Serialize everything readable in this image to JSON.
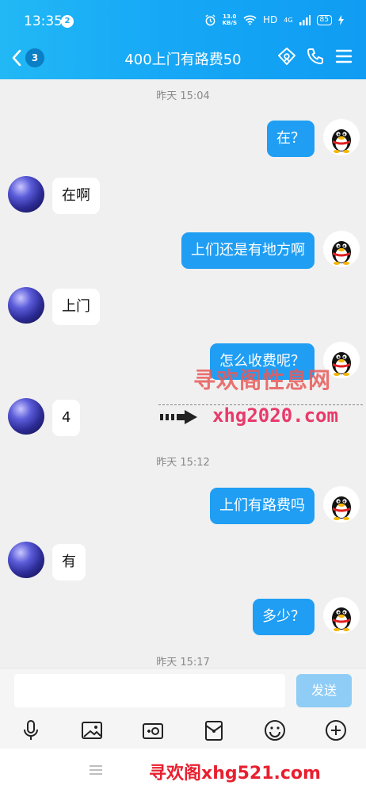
{
  "status_bar": {
    "time": "13:35",
    "notification_count": "2",
    "net_speed_value": "13.0",
    "net_speed_unit": "KB/S",
    "hd_label": "HD",
    "signal_label": "4G",
    "battery": "85"
  },
  "nav": {
    "unread_count": "3",
    "title": "400上门有路费50"
  },
  "messages": [
    {
      "type": "timestamp",
      "text": "昨天 15:04"
    },
    {
      "type": "self",
      "text": "在？"
    },
    {
      "type": "other",
      "text": "在啊"
    },
    {
      "type": "self",
      "text": "上们还是有地方啊"
    },
    {
      "type": "other",
      "text": "上门"
    },
    {
      "type": "self",
      "text": "怎么收费呢？"
    },
    {
      "type": "other",
      "text": "4"
    },
    {
      "type": "timestamp",
      "text": "昨天 15:12"
    },
    {
      "type": "self",
      "text": "上们有路费吗"
    },
    {
      "type": "other",
      "text": "有"
    },
    {
      "type": "self",
      "text": "多少？"
    },
    {
      "type": "timestamp",
      "text": "昨天 15:17"
    }
  ],
  "input": {
    "placeholder": "",
    "send_label": "发送"
  },
  "watermarks": {
    "middle_text": "寻欢阁性息网",
    "middle_url": "xhg2020.com",
    "bottom_text": "寻欢阁xhg521.com"
  },
  "colors": {
    "header_blue": "#16a8f6",
    "bubble_blue": "#1f9ef3",
    "send_disabled": "#8fcdf6"
  }
}
